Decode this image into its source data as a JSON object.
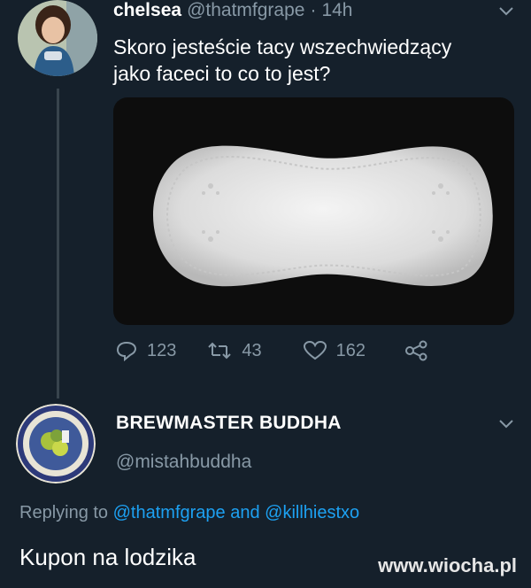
{
  "tweet": {
    "author_name": "chelsea",
    "author_handle": "@thatmfgrape",
    "separator": "·",
    "time": "14h",
    "text_line1": "Skoro jesteście tacy wszechwiedzący",
    "text_line2": "jako faceci to co to jest?",
    "menu_icon": "chevron-down-icon",
    "stats": {
      "replies": "123",
      "retweets": "43",
      "likes": "162"
    }
  },
  "reply": {
    "author_name": "BREWMASTER BUDDHA",
    "author_handle": "@mistahbuddha",
    "replying_prefix": "Replying to",
    "replying_user1": "@thatmfgrape",
    "replying_and": "and",
    "replying_user2": "@killhiestxo",
    "text": "Kupon na lodzika",
    "menu_icon": "chevron-down-icon"
  },
  "watermark": "www.wiocha.pl",
  "colors": {
    "background": "#15202b",
    "secondary_text": "#8899a6",
    "link": "#1da1f2"
  }
}
